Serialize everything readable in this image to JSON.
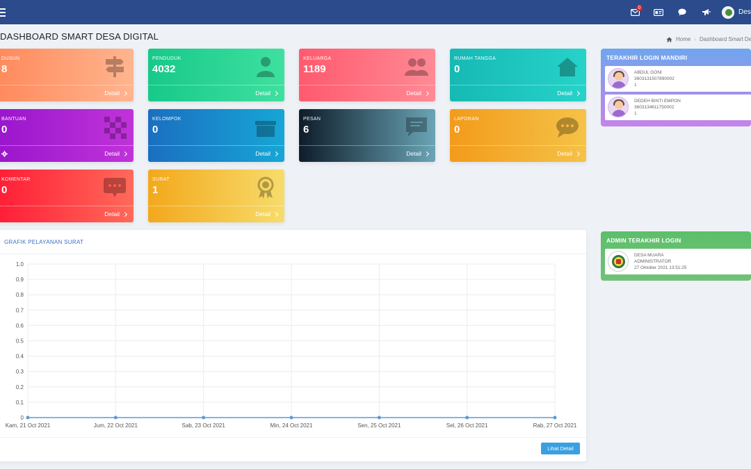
{
  "topbar": {
    "message_badge": "0",
    "user_name": "Desa Muara"
  },
  "page": {
    "title": "DASHBOARD SMART DESA DIGITAL",
    "breadcrumb": {
      "home": "Home",
      "current": "Dashboard Smart Desa Digital"
    }
  },
  "cards": [
    {
      "label": "DUSUN",
      "value": "8",
      "detail": "Detail",
      "icon": "signpost-icon"
    },
    {
      "label": "PENDUDUK",
      "value": "4032",
      "detail": "Detail",
      "icon": "person-icon"
    },
    {
      "label": "KELUARGA",
      "value": "1189",
      "detail": "Detail",
      "icon": "users-icon"
    },
    {
      "label": "RUMAH TANGGA",
      "value": "0",
      "detail": "Detail",
      "icon": "house-icon"
    },
    {
      "label": "BANTUAN",
      "value": "0",
      "detail": "Detail",
      "icon": "checker-icon"
    },
    {
      "label": "KELOMPOK",
      "value": "0",
      "detail": "Detail",
      "icon": "archive-icon"
    },
    {
      "label": "PESAN",
      "value": "6",
      "detail": "Detail",
      "icon": "message-icon"
    },
    {
      "label": "LAPORAN",
      "value": "0",
      "detail": "Detail",
      "icon": "chat-bubble-icon"
    },
    {
      "label": "KOMENTAR",
      "value": "0",
      "detail": "Detail",
      "icon": "comment-icon"
    },
    {
      "label": "SURAT",
      "value": "1",
      "detail": "Detail",
      "icon": "certificate-icon"
    }
  ],
  "colors": {
    "topbar": "#2b4b8c",
    "dusun": [
      "#ff8a5c",
      "#ffb58f"
    ],
    "penduduk": [
      "#17c98a",
      "#3fe09f"
    ],
    "keluarga": [
      "#ff5a6e",
      "#ff8a95"
    ],
    "rumah_tangga": [
      "#16b9b4",
      "#26d3c9"
    ],
    "bantuan": [
      "#9a16cc",
      "#c033d9"
    ],
    "kelompok": [
      "#1a6fc0",
      "#17a6d6"
    ],
    "pesan": [
      "#0e1c2b",
      "#6aa5b5"
    ],
    "laporan": [
      "#f39b1a",
      "#f5c247"
    ],
    "komentar": [
      "#ff1d36",
      "#ff6a5a"
    ],
    "surat": [
      "#f3a81c",
      "#f7dc6b"
    ]
  },
  "chart_panel": {
    "title": "GRAFIK PELAYANAN SURAT",
    "button": "Lihat Detail"
  },
  "chart_data": {
    "type": "line",
    "title": "GRAFIK PELAYANAN SURAT",
    "categories": [
      "Kam, 21 Oct 2021",
      "Jum, 22 Oct 2021",
      "Sab, 23 Oct 2021",
      "Min, 24 Oct 2021",
      "Sen, 25 Oct 2021",
      "Sel, 26 Oct 2021",
      "Rab, 27 Oct 2021"
    ],
    "series": [
      {
        "values": [
          0,
          0,
          0,
          0,
          0,
          0,
          0
        ]
      }
    ],
    "yticks": [
      "0",
      "0.1",
      "0.2",
      "0.3",
      "0.4",
      "0.5",
      "0.6",
      "0.7",
      "0.8",
      "0.9",
      "1.0"
    ],
    "ylim": [
      0,
      1
    ],
    "grid": true,
    "line_color": "#5b9bd5"
  },
  "login_mandiri": {
    "title": "TERAKHIR LOGIN MANDIRI",
    "items": [
      {
        "name": "ABDUL GONI",
        "nik": "3603131507890002",
        "extra": "1"
      },
      {
        "name": "DEDEH BINTI EMPON",
        "nik": "3603134611750002",
        "extra": "1"
      }
    ]
  },
  "admin_login": {
    "title": "ADMIN TERAKHIR LOGIN",
    "name": "DESA MUARA",
    "role": "ADMINISTRATOR",
    "time": "27 Oktober 2021 13:51:25"
  }
}
